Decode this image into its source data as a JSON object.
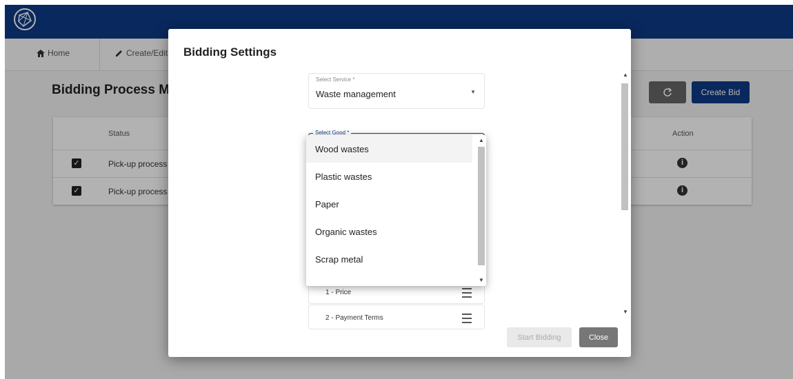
{
  "navbar": {
    "home_label": "Home",
    "create_edit_label": "Create/Edit"
  },
  "page": {
    "title": "Bidding Process Ma",
    "create_bid_label": "Create Bid"
  },
  "table": {
    "headers": {
      "status": "Status",
      "action": "Action"
    },
    "rows": [
      {
        "status": "Pick-up process",
        "checked": true
      },
      {
        "status": "Pick-up process",
        "checked": true
      }
    ]
  },
  "modal": {
    "title": "Bidding Settings",
    "service_field": {
      "label": "Select Service *",
      "value": "Waste management"
    },
    "good_field": {
      "label": "Select Good *"
    },
    "criteria": [
      "1 - Price",
      "2 - Payment Terms"
    ],
    "start_label": "Start Bidding",
    "close_label": "Close"
  },
  "dropdown": {
    "options": [
      "Wood wastes",
      "Plastic wastes",
      "Paper",
      "Organic wastes",
      "Scrap metal"
    ],
    "selected_index": 0
  },
  "colors": {
    "brand": "#0d3a86"
  }
}
